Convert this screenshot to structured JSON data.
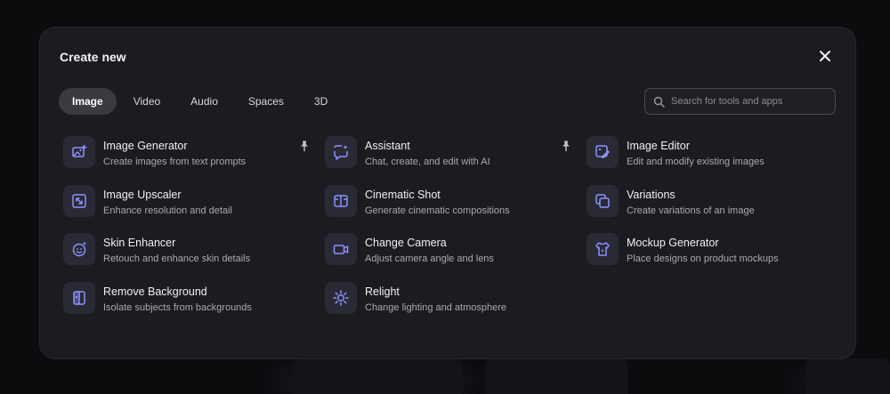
{
  "modal": {
    "title": "Create new",
    "close_icon": "close-icon"
  },
  "tabs": [
    {
      "label": "Image",
      "active": true
    },
    {
      "label": "Video",
      "active": false
    },
    {
      "label": "Audio",
      "active": false
    },
    {
      "label": "Spaces",
      "active": false
    },
    {
      "label": "3D",
      "active": false
    }
  ],
  "search": {
    "placeholder": "Search for tools and apps",
    "value": ""
  },
  "colors": {
    "modal_bg": "#1c1c20",
    "icon_tile_bg": "#2a2a35",
    "icon_accent": "#8b93ff",
    "active_tab_bg": "#3a3a40"
  },
  "tools": [
    {
      "name": "Image Generator",
      "desc": "Create images from text prompts",
      "icon": "image-plus-icon",
      "pinned": true
    },
    {
      "name": "Assistant",
      "desc": "Chat, create, and edit with AI",
      "icon": "chat-sparkle-icon",
      "pinned": true
    },
    {
      "name": "Image Editor",
      "desc": "Edit and modify existing images",
      "icon": "image-edit-icon",
      "pinned": false
    },
    {
      "name": "Image Upscaler",
      "desc": "Enhance resolution and detail",
      "icon": "upscale-icon",
      "pinned": false
    },
    {
      "name": "Cinematic Shot",
      "desc": "Generate cinematic compositions",
      "icon": "film-icon",
      "pinned": false
    },
    {
      "name": "Variations",
      "desc": "Create variations of an image",
      "icon": "copies-icon",
      "pinned": false
    },
    {
      "name": "Skin Enhancer",
      "desc": "Retouch and enhance skin details",
      "icon": "face-sparkle-icon",
      "pinned": false
    },
    {
      "name": "Change Camera",
      "desc": "Adjust camera angle and lens",
      "icon": "camera-icon",
      "pinned": false
    },
    {
      "name": "Mockup Generator",
      "desc": "Place designs on product mockups",
      "icon": "shirt-icon",
      "pinned": false
    },
    {
      "name": "Remove Background",
      "desc": "Isolate subjects from backgrounds",
      "icon": "cutout-icon",
      "pinned": false
    },
    {
      "name": "Relight",
      "desc": "Change lighting and atmosphere",
      "icon": "sun-icon",
      "pinned": false
    }
  ]
}
